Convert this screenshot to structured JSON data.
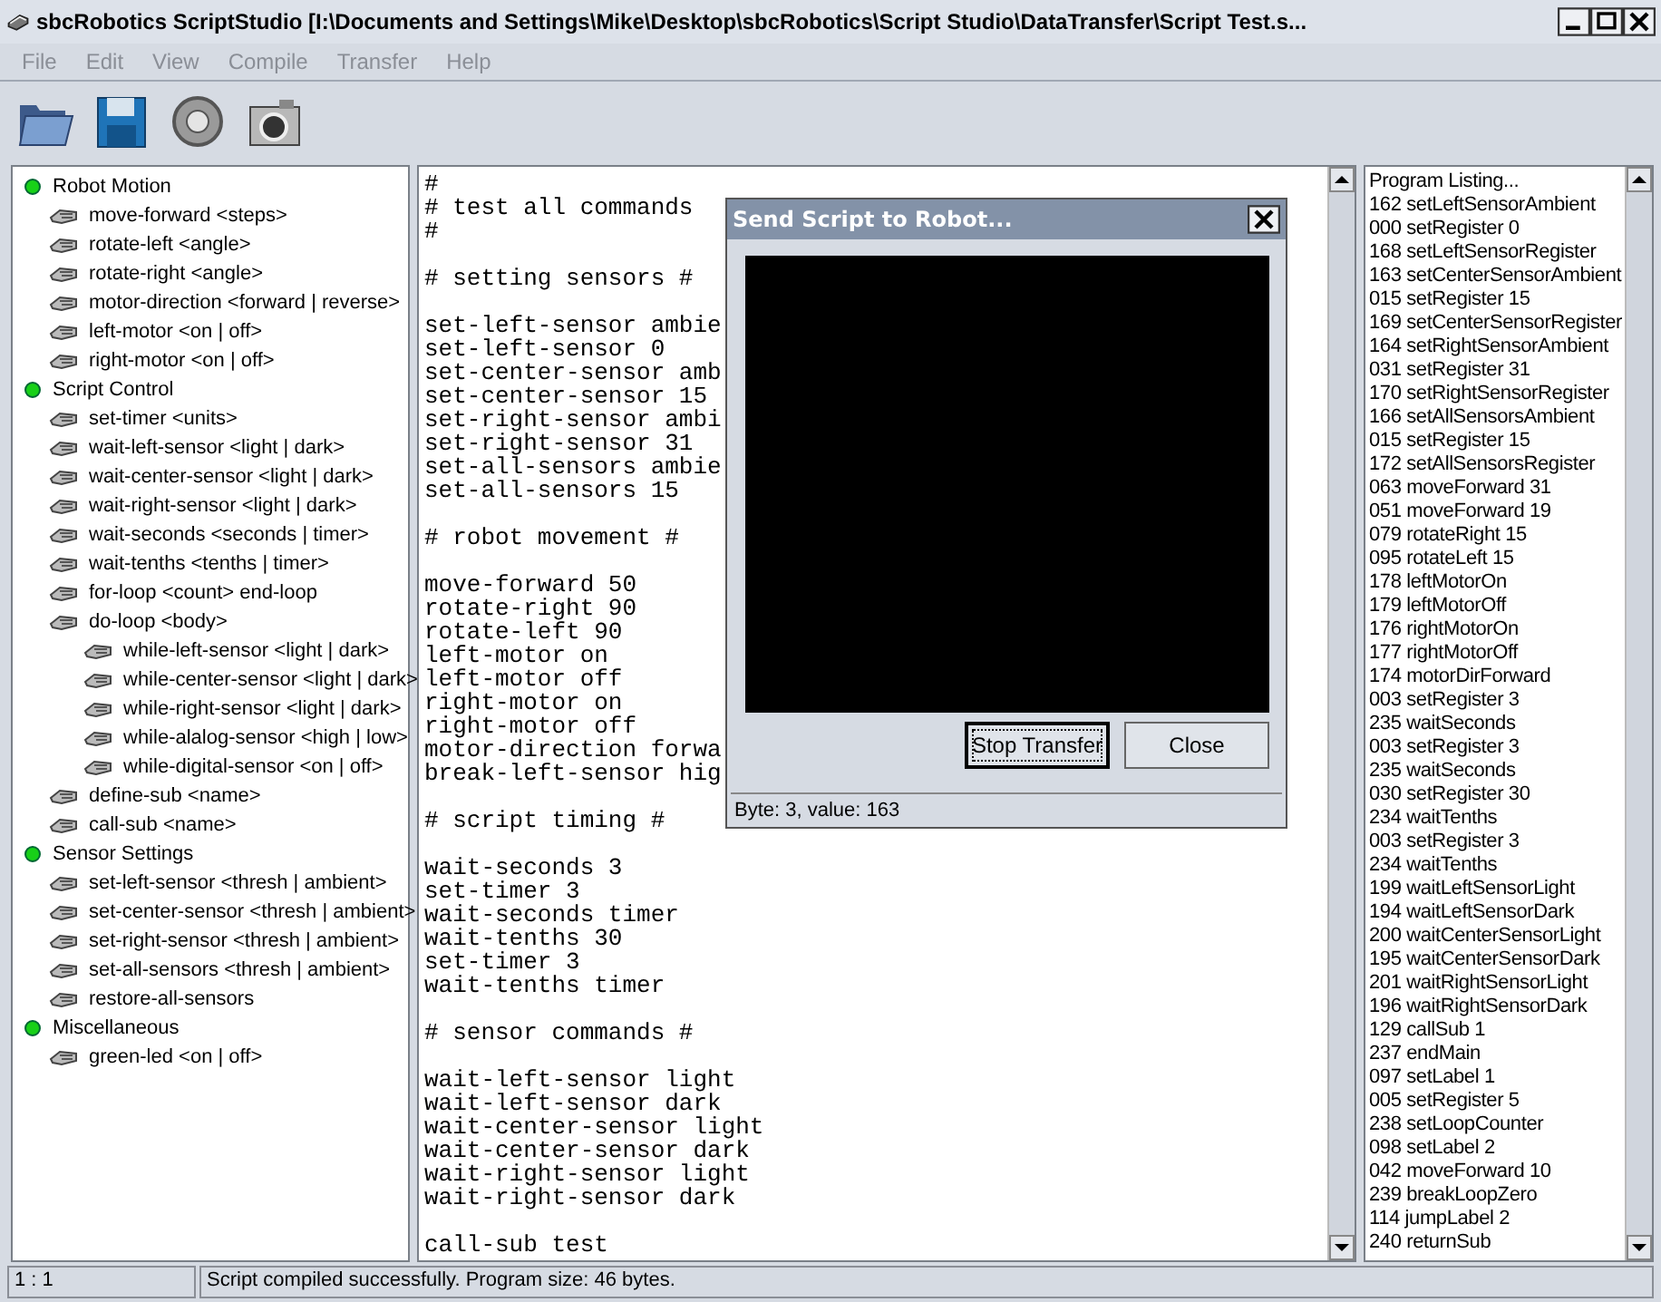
{
  "window": {
    "title": "sbcRobotics ScriptStudio [I:\\Documents and Settings\\Mike\\Desktop\\sbcRobotics\\Script Studio\\DataTransfer\\Script Test.s..."
  },
  "menu": [
    {
      "label": "File",
      "disabled": true
    },
    {
      "label": "Edit",
      "disabled": true
    },
    {
      "label": "View",
      "disabled": true
    },
    {
      "label": "Compile",
      "disabled": true
    },
    {
      "label": "Transfer",
      "disabled": true
    },
    {
      "label": "Help",
      "disabled": true
    }
  ],
  "toolbar": [
    {
      "kind": "open"
    },
    {
      "kind": "save"
    },
    {
      "kind": "compile"
    },
    {
      "kind": "camera"
    }
  ],
  "command_tree": [
    {
      "kind": "category",
      "label": "Robot Motion",
      "children": [
        {
          "kind": "command",
          "label": "move-forward <steps>"
        },
        {
          "kind": "command",
          "label": "rotate-left <angle>"
        },
        {
          "kind": "command",
          "label": "rotate-right <angle>"
        },
        {
          "kind": "command",
          "label": "motor-direction <forward | reverse>"
        },
        {
          "kind": "command",
          "label": "left-motor <on | off>"
        },
        {
          "kind": "command",
          "label": "right-motor <on | off>"
        }
      ]
    },
    {
      "kind": "category",
      "label": "Script Control",
      "children": [
        {
          "kind": "command",
          "label": "set-timer <units>"
        },
        {
          "kind": "command",
          "label": "wait-left-sensor <light | dark>"
        },
        {
          "kind": "command",
          "label": "wait-center-sensor <light | dark>"
        },
        {
          "kind": "command",
          "label": "wait-right-sensor <light | dark>"
        },
        {
          "kind": "command",
          "label": "wait-seconds <seconds | timer>"
        },
        {
          "kind": "command",
          "label": "wait-tenths <tenths | timer>"
        },
        {
          "kind": "command",
          "label": "for-loop <count> end-loop"
        },
        {
          "kind": "command",
          "label": "do-loop <body>",
          "children": [
            {
              "kind": "command",
              "label": "while-left-sensor <light | dark>"
            },
            {
              "kind": "command",
              "label": "while-center-sensor <light | dark>"
            },
            {
              "kind": "command",
              "label": "while-right-sensor <light | dark>"
            },
            {
              "kind": "command",
              "label": "while-alalog-sensor <high | low>"
            },
            {
              "kind": "command",
              "label": "while-digital-sensor <on | off>"
            }
          ]
        },
        {
          "kind": "command",
          "label": "define-sub <name>"
        },
        {
          "kind": "command",
          "label": "call-sub <name>"
        }
      ]
    },
    {
      "kind": "category",
      "label": "Sensor Settings",
      "children": [
        {
          "kind": "command",
          "label": "set-left-sensor <thresh | ambient>"
        },
        {
          "kind": "command",
          "label": "set-center-sensor <thresh | ambient>"
        },
        {
          "kind": "command",
          "label": "set-right-sensor <thresh | ambient>"
        },
        {
          "kind": "command",
          "label": "set-all-sensors <thresh | ambient>"
        },
        {
          "kind": "command",
          "label": "restore-all-sensors"
        }
      ]
    },
    {
      "kind": "category",
      "label": "Miscellaneous",
      "children": [
        {
          "kind": "command",
          "label": "green-led <on | off>"
        }
      ]
    }
  ],
  "editor": {
    "blocks": [
      [
        "#",
        "# test all commands",
        "#"
      ],
      [
        "# setting sensors #"
      ],
      [
        "set-left-sensor ambie",
        "set-left-sensor 0",
        "set-center-sensor amb",
        "set-center-sensor 15",
        "set-right-sensor ambi",
        "set-right-sensor 31",
        "set-all-sensors ambie",
        "set-all-sensors 15"
      ],
      [
        "# robot movement #"
      ],
      [
        "move-forward 50",
        "rotate-right 90",
        "rotate-left 90",
        "left-motor on",
        "left-motor off",
        "right-motor on",
        "right-motor off",
        "motor-direction forwa",
        "break-left-sensor hig"
      ],
      [
        "# script timing #"
      ],
      [
        "wait-seconds 3",
        "set-timer 3",
        "wait-seconds timer",
        "wait-tenths 30",
        "set-timer 3",
        "wait-tenths timer"
      ],
      [
        "# sensor commands #"
      ],
      [
        "wait-left-sensor light",
        "wait-left-sensor dark",
        "wait-center-sensor light",
        "wait-center-sensor dark",
        "wait-right-sensor light",
        "wait-right-sensor dark"
      ],
      [
        "call-sub test"
      ]
    ]
  },
  "listing": [
    "Program Listing...",
    "162 setLeftSensorAmbient",
    "000 setRegister 0",
    "168 setLeftSensorRegister",
    "163 setCenterSensorAmbient",
    "015 setRegister 15",
    "169 setCenterSensorRegister",
    "164 setRightSensorAmbient",
    "031 setRegister 31",
    "170 setRightSensorRegister",
    "166 setAllSensorsAmbient",
    "015 setRegister 15",
    "172 setAllSensorsRegister",
    "063 moveForward 31",
    "051 moveForward 19",
    "079 rotateRight 15",
    "095 rotateLeft 15",
    "178 leftMotorOn",
    "179 leftMotorOff",
    "176 rightMotorOn",
    "177 rightMotorOff",
    "174 motorDirForward",
    "003 setRegister 3",
    "235 waitSeconds",
    "003 setRegister 3",
    "235 waitSeconds",
    "030 setRegister 30",
    "234 waitTenths",
    "003 setRegister 3",
    "234 waitTenths",
    "199 waitLeftSensorLight",
    "194 waitLeftSensorDark",
    "200 waitCenterSensorLight",
    "195 waitCenterSensorDark",
    "201 waitRightSensorLight",
    "196 waitRightSensorDark",
    "129 callSub 1",
    "237 endMain",
    "097 setLabel 1",
    "005 setRegister 5",
    "238 setLoopCounter",
    "098 setLabel 2",
    "042 moveForward 10",
    "239 breakLoopZero",
    "114 jumpLabel 2",
    "240 returnSub"
  ],
  "dialog": {
    "title": "Send Script to Robot...",
    "buttons": [
      {
        "label": "Stop Transfer",
        "focused": true
      },
      {
        "label": "Close",
        "focused": false
      }
    ],
    "status": "Byte: 3, value: 163"
  },
  "status_bar": {
    "position": "1 : 1",
    "message": "Script compiled successfully. Program size: 46 bytes."
  }
}
